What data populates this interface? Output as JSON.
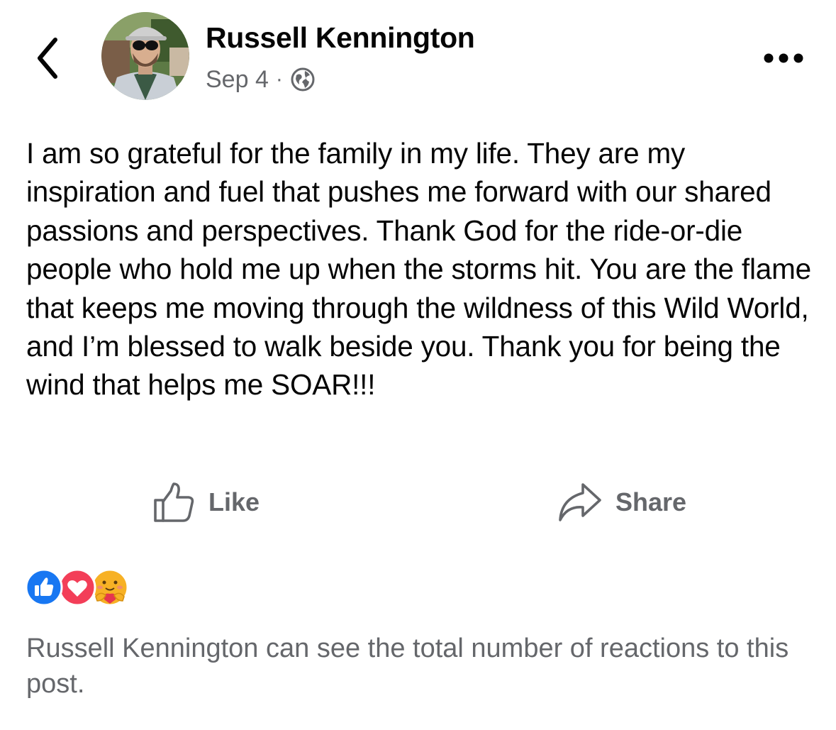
{
  "header": {
    "back_icon": "chevron-left-icon",
    "avatar_icon": "profile-photo",
    "author_name": "Russell Kennington",
    "timestamp": "Sep 4",
    "separator": "·",
    "privacy_icon": "globe-icon",
    "more_icon": "ellipsis-icon"
  },
  "post": {
    "text": "I am so grateful for the family in my life. They are my inspiration and fuel that pushes me forward with our shared passions and perspectives. Thank God for the ride-or-die people who hold me up when the storms hit. You are the flame that keeps me moving through the wildness of this Wild World, and I’m blessed to walk beside you. Thank you for being the wind that helps me SOAR!!!"
  },
  "actions": {
    "like_label": "Like",
    "like_icon": "thumbs-up-icon",
    "share_label": "Share",
    "share_icon": "share-arrow-icon"
  },
  "reactions": {
    "icons": [
      "like-reaction-icon",
      "love-reaction-icon",
      "care-reaction-icon"
    ],
    "note": "Russell Kennington can see the total number of reactions to this post."
  },
  "colors": {
    "primary_text": "#050505",
    "secondary_text": "#65676b",
    "like_blue": "#1877f2",
    "love_red": "#f33e58",
    "care_yellow": "#f7b125"
  }
}
